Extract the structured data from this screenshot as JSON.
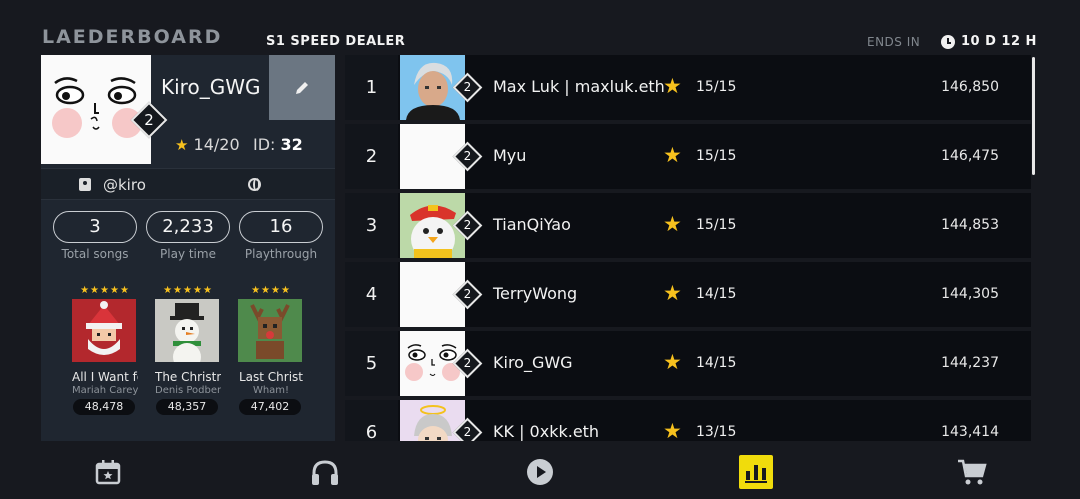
{
  "header": {
    "title": "LAEDERBOARD",
    "subtitle": "S1  SPEED DEALER",
    "ends_label": "ENDS IN",
    "ends_value": "10 D 12 H"
  },
  "profile": {
    "name": "Kiro_GWG",
    "level": "2",
    "stars": "14/20",
    "id_label": "ID:",
    "id_value": "32",
    "handle": "@kiro",
    "stats": [
      {
        "value": "3",
        "label": "Total songs"
      },
      {
        "value": "2,233",
        "label": "Play time"
      },
      {
        "value": "16",
        "label": "Playthrough"
      }
    ],
    "songs": [
      {
        "stars": "★★★★★",
        "title": "All I Want fo",
        "artist": "Mariah Carey",
        "score": "48,478"
      },
      {
        "stars": "★★★★★",
        "title": "The Christn",
        "artist": "Denis Podber",
        "score": "48,357"
      },
      {
        "stars": "★★★★",
        "title": "Last Christ",
        "artist": "Wham!",
        "score": "47,402"
      }
    ]
  },
  "leaderboard": [
    {
      "rank": "1",
      "level": "2",
      "name": "Max Luk | maxluk.eth",
      "count": "15/15",
      "score": "146,850"
    },
    {
      "rank": "2",
      "level": "2",
      "name": "Myu",
      "count": "15/15",
      "score": "146,475"
    },
    {
      "rank": "3",
      "level": "2",
      "name": "TianQiYao",
      "count": "15/15",
      "score": "144,853"
    },
    {
      "rank": "4",
      "level": "2",
      "name": "TerryWong",
      "count": "14/15",
      "score": "144,305"
    },
    {
      "rank": "5",
      "level": "2",
      "name": "Kiro_GWG",
      "count": "14/15",
      "score": "144,237"
    },
    {
      "rank": "6",
      "level": "2",
      "name": "KK | 0xkk.eth",
      "count": "13/15",
      "score": "143,414"
    }
  ],
  "nav": {
    "items": [
      "calendar-star-icon",
      "headphones-icon",
      "play-icon",
      "leaderboard-icon",
      "cart-icon"
    ],
    "active": "leaderboard-icon"
  },
  "colors": {
    "accent": "#f0dc0c",
    "star": "#f7c11e",
    "panel": "#1f2630",
    "row": "#0b0d12"
  }
}
